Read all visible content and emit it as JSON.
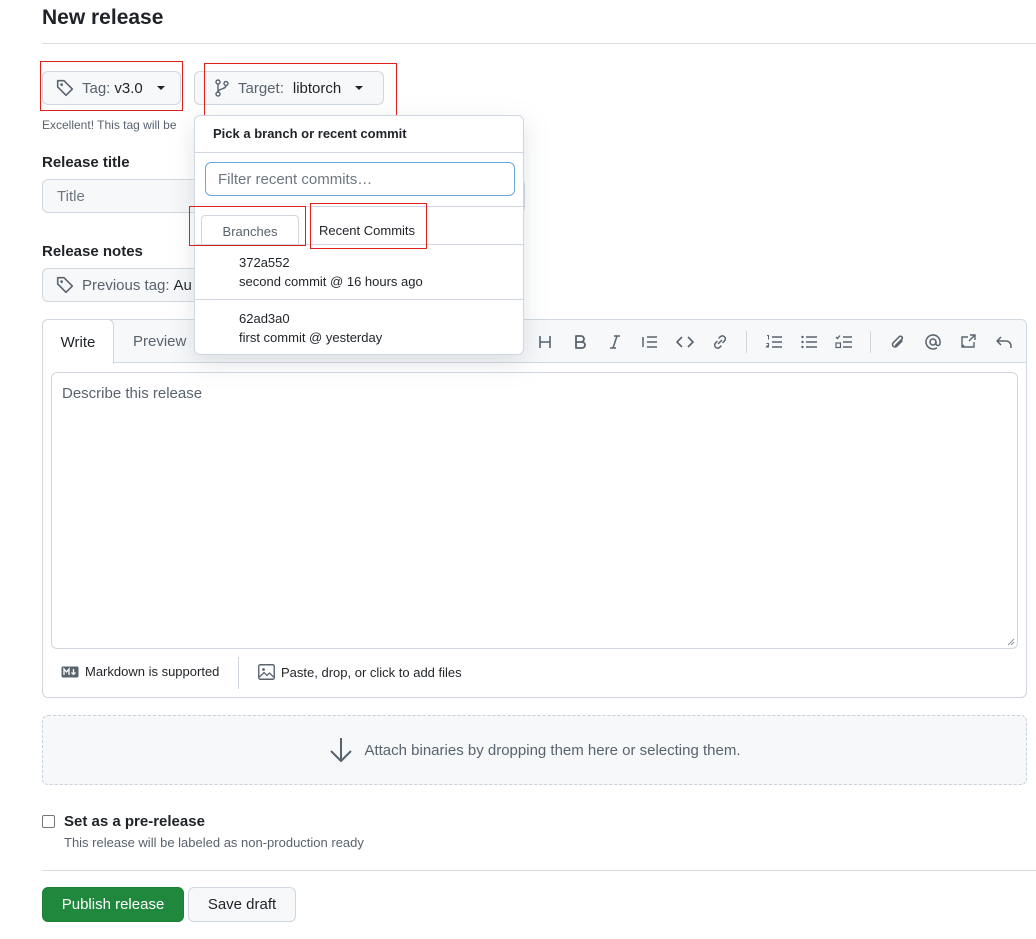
{
  "header": {
    "title": "New release"
  },
  "tag_button": {
    "prefix": "Tag:",
    "value": "v3.0"
  },
  "target_button": {
    "prefix": "Target:",
    "value": "libtorch"
  },
  "tag_note": "Excellent! This tag will be",
  "release_title": {
    "label": "Release title",
    "placeholder": "Title"
  },
  "release_notes": {
    "label": "Release notes",
    "previous_tag_prefix": "Previous tag:",
    "previous_tag_value": "Au"
  },
  "editor": {
    "tabs": {
      "write": "Write",
      "preview": "Preview"
    },
    "placeholder": "Describe this release",
    "footer": {
      "markdown": "Markdown is supported",
      "files": "Paste, drop, or click to add files"
    }
  },
  "attach": {
    "text": "Attach binaries by dropping them here or selecting them."
  },
  "prerelease": {
    "label": "Set as a pre-release",
    "description": "This release will be labeled as non-production ready"
  },
  "actions": {
    "publish": "Publish release",
    "draft": "Save draft"
  },
  "dropdown": {
    "title": "Pick a branch or recent commit",
    "filter_placeholder": "Filter recent commits…",
    "tabs": {
      "branches": "Branches",
      "recent": "Recent Commits"
    },
    "commits": [
      {
        "sha": "372a552",
        "message": "second commit @ 16 hours ago"
      },
      {
        "sha": "62ad3a0",
        "message": "first commit @ yesterday"
      }
    ]
  },
  "colors": {
    "primary_button": "#1f883d",
    "highlight_box": "#e0201b",
    "border": "#d0d7de"
  }
}
